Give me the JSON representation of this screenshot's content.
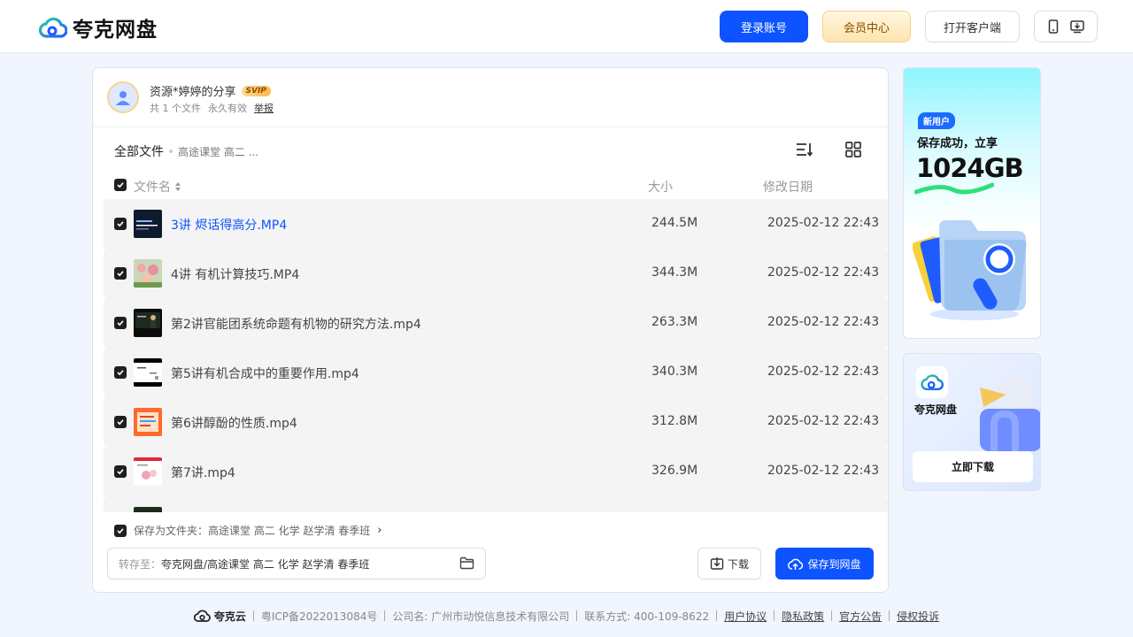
{
  "header": {
    "logo_text": "夸克网盘",
    "login_label": "登录账号",
    "vip_label": "会员中心",
    "client_label": "打开客户端",
    "accent": "#0d53ff"
  },
  "share": {
    "title": "资源*婷婷的分享",
    "badge": "SVIP",
    "file_count": "共 1 个文件",
    "validity": "永久有效",
    "report": "举报"
  },
  "breadcrumb": {
    "root": "全部文件",
    "current": "高途课堂 高二 ..."
  },
  "columns": {
    "name": "文件名",
    "size": "大小",
    "date": "修改日期"
  },
  "files": [
    {
      "name": "3讲 烬话得高分.MP4",
      "size": "244.5M",
      "date": "2025-02-12 22:43",
      "active": true,
      "thumb": "dark-slide"
    },
    {
      "name": "4讲 有机计算技巧.MP4",
      "size": "344.3M",
      "date": "2025-02-12 22:43",
      "active": false,
      "thumb": "flowers"
    },
    {
      "name": "第2讲官能团系统命题有机物的研究方法.mp4",
      "size": "263.3M",
      "date": "2025-02-12 22:43",
      "active": false,
      "thumb": "presenter"
    },
    {
      "name": "第5讲有机合成中的重要作用.mp4",
      "size": "340.3M",
      "date": "2025-02-12 22:43",
      "active": false,
      "thumb": "whiteboard"
    },
    {
      "name": "第6讲醇酚的性质.mp4",
      "size": "312.8M",
      "date": "2025-02-12 22:43",
      "active": false,
      "thumb": "orange-slide"
    },
    {
      "name": "第7讲.mp4",
      "size": "326.9M",
      "date": "2025-02-12 22:43",
      "active": false,
      "thumb": "pink-slide"
    }
  ],
  "footer_bar": {
    "save_as_folder": "保存为文件夹：高途课堂 高二 化学 赵学清 春季班",
    "path_label": "转存至：",
    "path_value": "夸克网盘/高途课堂 高二 化学 赵学清 春季班",
    "download_label": "下载",
    "save_label": "保存到网盘"
  },
  "ads": {
    "ad1_badge": "新用户",
    "ad1_line": "保存成功，立享",
    "ad1_big": "1024GB",
    "ad2_name": "夸克网盘",
    "ad2_button": "立即下载"
  },
  "page_footer": {
    "brand": "夸克云",
    "icp": "粤ICP备2022013084号",
    "company": "公司名: 广州市动悦信息技术有限公司",
    "contact": "联系方式: 400-109-8622",
    "links": [
      "用户协议",
      "隐私政策",
      "官方公告",
      "侵权投诉"
    ]
  }
}
